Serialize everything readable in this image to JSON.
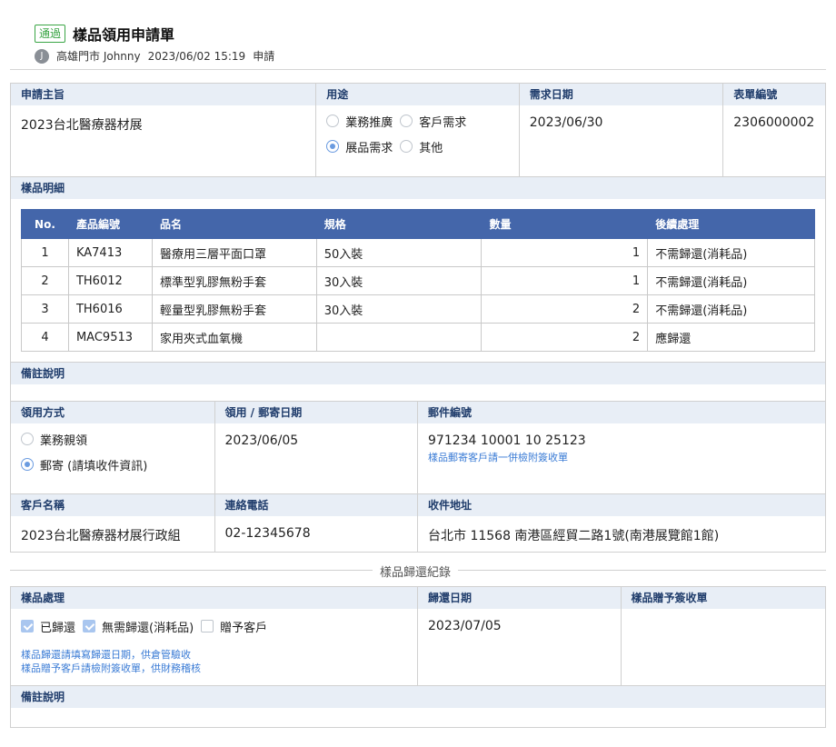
{
  "header": {
    "status_badge": "通過",
    "title": "樣品領用申請單",
    "avatar_initial": "J",
    "applicant": "高雄門市 Johnny",
    "datetime": "2023/06/02 15:19",
    "action": "申請"
  },
  "request": {
    "subject_label": "申請主旨",
    "subject_value": "2023台北醫療器材展",
    "purpose_label": "用途",
    "purpose_options": [
      "業務推廣",
      "客戶需求",
      "展品需求",
      "其他"
    ],
    "purpose_selected": "展品需求",
    "need_date_label": "需求日期",
    "need_date_value": "2023/06/30",
    "form_no_label": "表單編號",
    "form_no_value": "2306000002"
  },
  "items": {
    "section_label": "樣品明細",
    "columns": [
      "No.",
      "產品編號",
      "品名",
      "規格",
      "數量",
      "後續處理"
    ],
    "rows": [
      {
        "no": "1",
        "code": "KA7413",
        "name": "醫療用三層平面口罩",
        "spec": "50入裝",
        "qty": "1",
        "follow": "不需歸還(消耗品)"
      },
      {
        "no": "2",
        "code": "TH6012",
        "name": "標準型乳膠無粉手套",
        "spec": "30入裝",
        "qty": "1",
        "follow": "不需歸還(消耗品)"
      },
      {
        "no": "3",
        "code": "TH6016",
        "name": "輕量型乳膠無粉手套",
        "spec": "30入裝",
        "qty": "2",
        "follow": "不需歸還(消耗品)"
      },
      {
        "no": "4",
        "code": "MAC9513",
        "name": "家用夾式血氧機",
        "spec": "",
        "qty": "2",
        "follow": "應歸還"
      }
    ]
  },
  "remark1": {
    "label": "備註說明",
    "value": ""
  },
  "pickup": {
    "method_label": "領用方式",
    "method_options": [
      "業務親領",
      "郵寄 (請填收件資訊)"
    ],
    "method_selected": "郵寄 (請填收件資訊)",
    "date_label": "領用 / 郵寄日期",
    "date_value": "2023/06/05",
    "tracking_label": "郵件編號",
    "tracking_value": "971234 10001 10 25123",
    "tracking_note": "樣品郵寄客戶請一併檢附簽收單",
    "customer_label": "客戶名稱",
    "customer_value": "2023台北醫療器材展行政組",
    "phone_label": "連絡電話",
    "phone_value": "02-12345678",
    "address_label": "收件地址",
    "address_value": "台北市 11568 南港區經貿二路1號(南港展覽館1館)"
  },
  "return_section": {
    "divider_title": "樣品歸還紀錄",
    "handling_label": "樣品處理",
    "handling_options": [
      {
        "label": "已歸還",
        "checked": true
      },
      {
        "label": "無需歸還(消耗品)",
        "checked": true
      },
      {
        "label": "贈予客戶",
        "checked": false
      }
    ],
    "note_line1": "樣品歸還請填寫歸還日期，供倉管驗收",
    "note_line2": "樣品贈予客戶請檢附簽收單，供財務稽核",
    "return_date_label": "歸還日期",
    "return_date_value": "2023/07/05",
    "gift_receipt_label": "樣品贈予簽收單",
    "remark_label": "備註說明",
    "remark_value": ""
  },
  "colors": {
    "label_bg": "#e8eef6",
    "label_text": "#1f3c6b",
    "table_header": "#4466aa",
    "approved": "#3aa545",
    "link": "#3a7bd5"
  }
}
